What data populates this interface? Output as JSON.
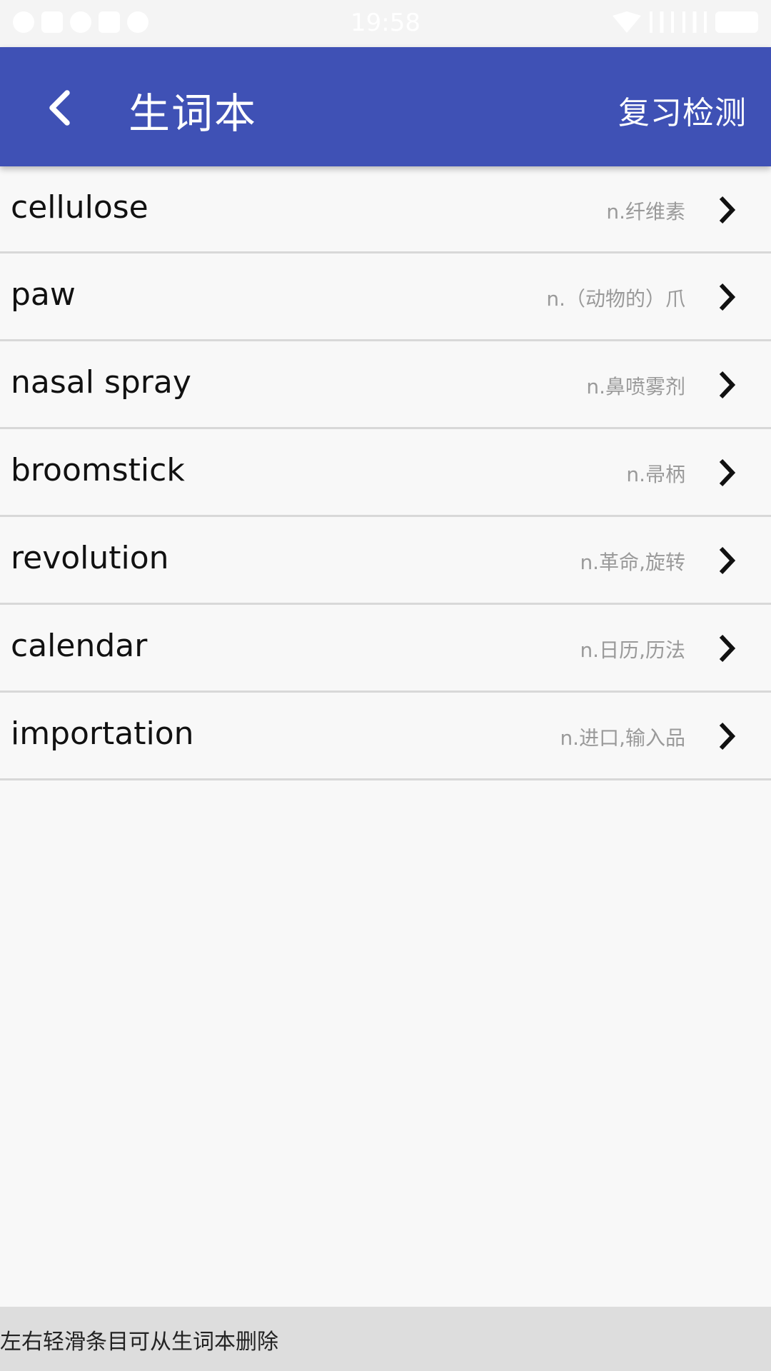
{
  "status_bar": {
    "time": "19:58"
  },
  "app_bar": {
    "title": "生词本",
    "action_label": "复习检测",
    "back_icon": "chevron-left-icon",
    "color": "#3f51b5"
  },
  "words": [
    {
      "word": "cellulose",
      "meaning": "n.纤维素"
    },
    {
      "word": "paw",
      "meaning": "n.（动物的）爪"
    },
    {
      "word": "nasal spray",
      "meaning": "n.鼻喷雾剂"
    },
    {
      "word": "broomstick",
      "meaning": "n.帚柄"
    },
    {
      "word": "revolution",
      "meaning": "n.革命,旋转"
    },
    {
      "word": "calendar",
      "meaning": "n.日历,历法"
    },
    {
      "word": "importation",
      "meaning": "n.进口,输入品"
    }
  ],
  "hint": {
    "text": "左右轻滑条目可从生词本删除"
  }
}
